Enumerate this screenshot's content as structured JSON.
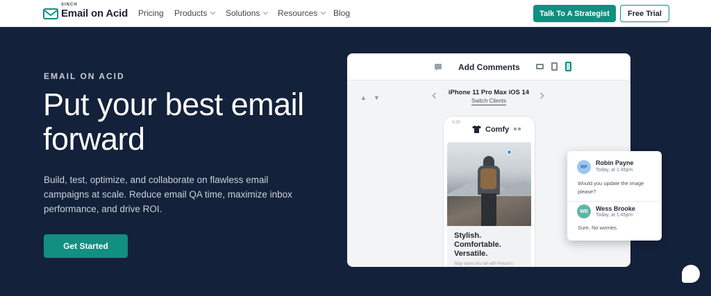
{
  "header": {
    "logo_small": "SINCH",
    "logo_name": "Email on Acid",
    "nav": [
      {
        "label": "Pricing",
        "dropdown": false
      },
      {
        "label": "Products",
        "dropdown": true
      },
      {
        "label": "Solutions",
        "dropdown": true
      },
      {
        "label": "Resources",
        "dropdown": true
      },
      {
        "label": "Blog",
        "dropdown": false
      }
    ],
    "cta_primary": "Talk To A Strategist",
    "cta_secondary": "Free Trial"
  },
  "hero": {
    "eyebrow": "EMAIL ON ACID",
    "headline": "Put your best email forward",
    "subtitle": "Build, test, optimize, and collaborate on flawless email campaigns at scale. Reduce email QA time, maximize inbox performance, and drive ROI.",
    "cta": "Get Started"
  },
  "preview": {
    "title": "Add Comments",
    "device": "iPhone 11 Pro Max iOS 14",
    "switch_link": "Switch Clients",
    "phone": {
      "time": "4:20",
      "brand": "Comfy",
      "card_title": "Stylish. Comfortable. Versatile.",
      "card_sub": "Stay warm this fall with Felson's"
    }
  },
  "comments": [
    {
      "initials": "RP",
      "name": "Robin Payne",
      "time": "Today, at 1:45pm",
      "text": "Would you update the image please?"
    },
    {
      "initials": "WB",
      "name": "Wess Brooke",
      "time": "Today, at 1:45pm",
      "text": "Sure, No worries."
    }
  ],
  "colors": {
    "brand_teal": "#118f80",
    "hero_bg": "#13213a",
    "nav_bg": "#ffffff"
  }
}
